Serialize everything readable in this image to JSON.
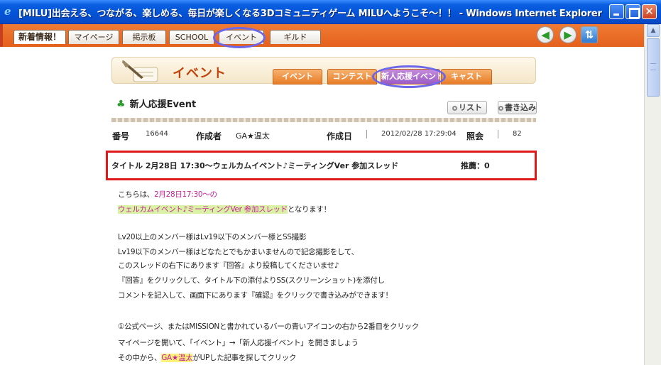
{
  "window": {
    "title": "[MILU]出会える、つながる、楽しめる、毎日が楽しくなる3Dコミュニティゲーム MILUへようこそ～！！ - Windows Internet Explorer",
    "app_icon": "ie-icon",
    "buttons": {
      "minimize": "",
      "maximize": "",
      "close": "✕"
    }
  },
  "game_nav": {
    "tabs": [
      {
        "label": "新着情報！"
      },
      {
        "label": "マイページ"
      },
      {
        "label": "掲示板"
      },
      {
        "label": "SCHOOL"
      },
      {
        "label": "イベント"
      },
      {
        "label": "ギルド"
      }
    ],
    "back_icon": "green-left-arrow",
    "forward_icon": "green-right-arrow",
    "refresh_icon": "refresh-arrows"
  },
  "banner": {
    "title": "イベント",
    "subtabs": [
      {
        "label": "イベント"
      },
      {
        "label": "コンテスト"
      },
      {
        "label": "新人応援イベント"
      },
      {
        "label": "キャスト"
      }
    ]
  },
  "section": {
    "title": "新人応援Event",
    "list_button": "リスト",
    "write_button": "書き込み"
  },
  "post_meta": {
    "number_label": "番号",
    "number_value": "16644",
    "author_label": "作成者",
    "author_value": "GA★温太",
    "date_label": "作成日",
    "date_value": "2012/02/28 17:29:04",
    "views_label": "照会",
    "views_value": "82"
  },
  "post_title": {
    "text": "タイトル 2月28日 17:30～ウェルカムイベント♪ミーティングVer 参加スレッド",
    "recommend": "推薦：0"
  },
  "post_body": {
    "l1_pre": "こちらは、",
    "l1_pink": "2月28日17:30～の",
    "l2_hl": "ウェルカムイベント♪ミーティングVer 参加スレッド",
    "l2_post": "となります！",
    "l3": "Lv20以上のメンバー様はLv19以下のメンバー様とSS撮影",
    "l4": "Lv19以下のメンバー様はどなたとでもかまいませんので記念撮影をして、",
    "l5": "このスレッドの右下にあります『回答』より投稿してくださいませ♪",
    "l6": "『回答』をクリックして、タイトル下の添付よりSS(スクリーンショット)を添付し",
    "l7": "コメントを記入して、画面下にあります『確認』をクリックで書き込みができます！",
    "l8": "①公式ページ、またはMISSIONと書かれているバーの青いアイコンの右から2番目をクリック",
    "l9": "マイページを開いて、「イベント」→「新人応援イベント」を開きましょう",
    "l10_pre": "その中から、",
    "l10_hl": "GA★温太",
    "l10_post": "がUPした記事を探してクリック"
  }
}
